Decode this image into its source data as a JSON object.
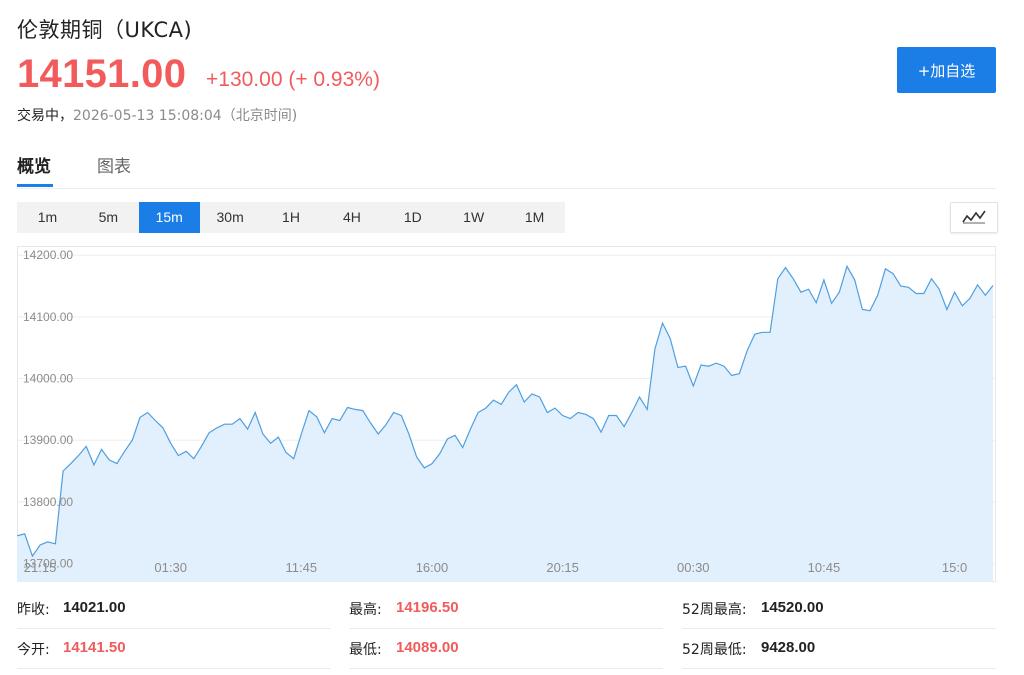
{
  "header": {
    "title": "伦敦期铜（UKCA)",
    "price": "14151.00",
    "change": "+130.00 (+ 0.93%)",
    "status_label": "交易中，",
    "timestamp": "2026-05-13 15:08:04（北京时间)",
    "add_button": "+加自选"
  },
  "tabs": [
    {
      "label": "概览",
      "active": true
    },
    {
      "label": "图表",
      "active": false
    }
  ],
  "periods": [
    {
      "label": "1m",
      "active": false
    },
    {
      "label": "5m",
      "active": false
    },
    {
      "label": "15m",
      "active": true
    },
    {
      "label": "30m",
      "active": false
    },
    {
      "label": "1H",
      "active": false
    },
    {
      "label": "4H",
      "active": false
    },
    {
      "label": "1D",
      "active": false
    },
    {
      "label": "1W",
      "active": false
    },
    {
      "label": "1M",
      "active": false
    }
  ],
  "chart_toggle_icon": "line-chart-icon",
  "colors": {
    "accent": "#1a7ee6",
    "up": "#f25b5b",
    "line": "#4f9fe0",
    "fill": "#e2effc"
  },
  "chart_data": {
    "type": "area",
    "yticks": [
      "14200.00",
      "14100.00",
      "14000.00",
      "13900.00",
      "13800.00",
      "13700.00"
    ],
    "ytick_values": [
      14200,
      14100,
      14000,
      13900,
      13800,
      13700
    ],
    "ylim": [
      13670,
      14215
    ],
    "xticks": [
      {
        "label": "21:15",
        "index": 3
      },
      {
        "label": "01:30",
        "index": 20
      },
      {
        "label": "11:45",
        "index": 37
      },
      {
        "label": "16:00",
        "index": 54
      },
      {
        "label": "20:15",
        "index": 71
      },
      {
        "label": "00:30",
        "index": 88
      },
      {
        "label": "10:45",
        "index": 105
      },
      {
        "label": "15:0",
        "index": 122
      }
    ],
    "values": [
      13745,
      13748,
      13712,
      13730,
      13735,
      13732,
      13850,
      13862,
      13875,
      13890,
      13860,
      13885,
      13868,
      13862,
      13882,
      13900,
      13937,
      13945,
      13932,
      13920,
      13895,
      13875,
      13882,
      13870,
      13890,
      13912,
      13920,
      13926,
      13926,
      13935,
      13918,
      13945,
      13910,
      13895,
      13905,
      13880,
      13870,
      13910,
      13948,
      13938,
      13912,
      13935,
      13932,
      13953,
      13950,
      13948,
      13928,
      13910,
      13925,
      13945,
      13940,
      13910,
      13873,
      13855,
      13862,
      13878,
      13902,
      13908,
      13888,
      13918,
      13945,
      13952,
      13965,
      13958,
      13978,
      13990,
      13962,
      13975,
      13970,
      13945,
      13952,
      13940,
      13935,
      13945,
      13942,
      13935,
      13913,
      13940,
      13940,
      13922,
      13945,
      13970,
      13950,
      14048,
      14090,
      14065,
      14018,
      14020,
      13988,
      14022,
      14020,
      14025,
      14020,
      14005,
      14008,
      14045,
      14072,
      14075,
      14075,
      14162,
      14180,
      14162,
      14140,
      14145,
      14123,
      14160,
      14122,
      14140,
      14182,
      14160,
      14112,
      14110,
      14135,
      14178,
      14170,
      14150,
      14148,
      14138,
      14138,
      14162,
      14145,
      14112,
      14140,
      14118,
      14130,
      14152,
      14135,
      14151
    ]
  },
  "stats": [
    {
      "label": "昨收:",
      "value": "14021.00",
      "color": "dark"
    },
    {
      "label": "最高:",
      "value": "14196.50",
      "color": "red"
    },
    {
      "label": "52周最高:",
      "value": "14520.00",
      "color": "dark"
    },
    {
      "label": "今开:",
      "value": "14141.50",
      "color": "red"
    },
    {
      "label": "最低:",
      "value": "14089.00",
      "color": "red"
    },
    {
      "label": "52周最低:",
      "value": "9428.00",
      "color": "dark"
    }
  ]
}
